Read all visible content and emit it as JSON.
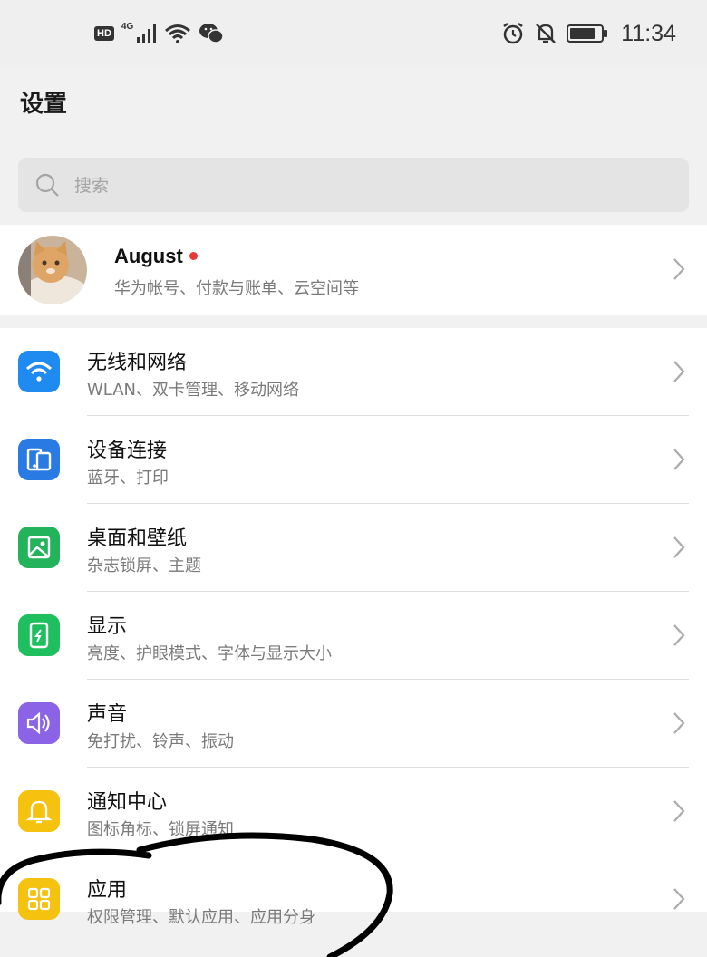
{
  "status_bar": {
    "hd_label": "HD",
    "network_label": "4G",
    "time": "11:34",
    "icons": [
      "hd-badge",
      "signal-icon",
      "wifi-icon",
      "wechat-icon",
      "alarm-icon",
      "mute-bell-icon",
      "battery-icon"
    ]
  },
  "header": {
    "title": "设置"
  },
  "search": {
    "placeholder": "搜索"
  },
  "account": {
    "name": "August",
    "subtitle": "华为帐号、付款与账单、云空间等",
    "has_notification_dot": true
  },
  "settings_items": [
    {
      "id": "wireless",
      "title": "无线和网络",
      "subtitle": "WLAN、双卡管理、移动网络",
      "icon": "wifi-icon",
      "color": "#1f8bf0"
    },
    {
      "id": "device-connection",
      "title": "设备连接",
      "subtitle": "蓝牙、打印",
      "icon": "device-connect-icon",
      "color": "#2a7ae4"
    },
    {
      "id": "desktop-wallpaper",
      "title": "桌面和壁纸",
      "subtitle": "杂志锁屏、主题",
      "icon": "wallpaper-icon",
      "color": "#22b35b"
    },
    {
      "id": "display",
      "title": "显示",
      "subtitle": "亮度、护眼模式、字体与显示大小",
      "icon": "display-icon",
      "color": "#1fbf5f"
    },
    {
      "id": "sound",
      "title": "声音",
      "subtitle": "免打扰、铃声、振动",
      "icon": "speaker-icon",
      "color": "#8b63e6"
    },
    {
      "id": "notifications",
      "title": "通知中心",
      "subtitle": "图标角标、锁屏通知",
      "icon": "bell-icon",
      "color": "#f5c20f"
    },
    {
      "id": "apps",
      "title": "应用",
      "subtitle": "权限管理、默认应用、应用分身",
      "icon": "apps-grid-icon",
      "color": "#f5c20f"
    }
  ],
  "colors": {
    "background": "#f1f1f1",
    "search_bg": "#e4e4e4",
    "red_dot": "#e53935",
    "annotation_ink": "#000000"
  }
}
